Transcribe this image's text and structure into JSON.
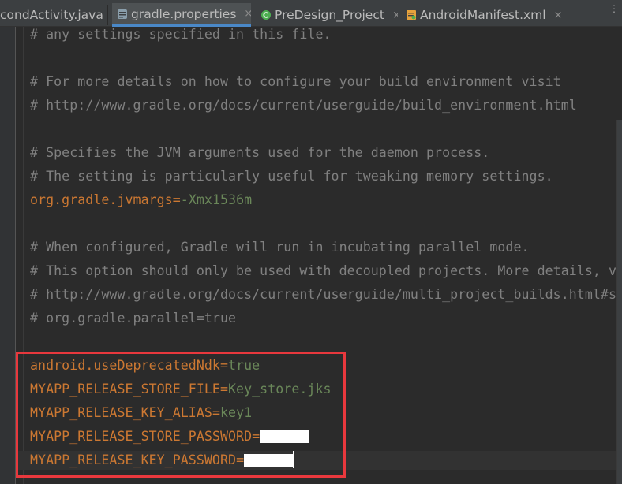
{
  "tabs": [
    {
      "label": "condActivity.java",
      "icon": "java-class-icon",
      "active": false
    },
    {
      "label": "gradle.properties",
      "icon": "gradle-properties-icon",
      "active": true
    },
    {
      "label": "PreDesign_Project",
      "icon": "gradle-module-icon",
      "active": false
    },
    {
      "label": "AndroidManifest.xml",
      "icon": "xml-manifest-icon",
      "active": false
    }
  ],
  "tab_close_glyph": "×",
  "tab_overflow_glyph": "⋮",
  "editor": {
    "lines": [
      {
        "type": "comment",
        "text": "# any settings specified in this file."
      },
      {
        "type": "blank",
        "text": ""
      },
      {
        "type": "comment",
        "text": "# For more details on how to configure your build environment visit"
      },
      {
        "type": "comment",
        "text": "# http://www.gradle.org/docs/current/userguide/build_environment.html"
      },
      {
        "type": "blank",
        "text": ""
      },
      {
        "type": "comment",
        "text": "# Specifies the JVM arguments used for the daemon process."
      },
      {
        "type": "comment",
        "text": "# The setting is particularly useful for tweaking memory settings."
      },
      {
        "type": "property",
        "key": "org.gradle.jvmargs",
        "eq": "=",
        "value": "-Xmx1536m"
      },
      {
        "type": "blank",
        "text": ""
      },
      {
        "type": "comment",
        "text": "# When configured, Gradle will run in incubating parallel mode."
      },
      {
        "type": "comment",
        "text": "# This option should only be used with decoupled projects. More details, visit"
      },
      {
        "type": "comment",
        "text": "# http://www.gradle.org/docs/current/userguide/multi_project_builds.html#sec:decoupled_projects"
      },
      {
        "type": "comment",
        "text": "# org.gradle.parallel=true"
      },
      {
        "type": "blank",
        "text": ""
      },
      {
        "type": "property",
        "key": "android.useDeprecatedNdk",
        "eq": "=",
        "value": "true"
      },
      {
        "type": "property",
        "key": "MYAPP_RELEASE_STORE_FILE",
        "eq": "=",
        "value": "Key_store.jks"
      },
      {
        "type": "property",
        "key": "MYAPP_RELEASE_KEY_ALIAS",
        "eq": "=",
        "value": "key1"
      },
      {
        "type": "property",
        "key": "MYAPP_RELEASE_STORE_PASSWORD",
        "eq": "=",
        "value": "",
        "redacted": true
      },
      {
        "type": "property",
        "key": "MYAPP_RELEASE_KEY_PASSWORD",
        "eq": "=",
        "value": "",
        "redacted": true,
        "current": true
      }
    ]
  },
  "colors": {
    "background": "#2b2b2b",
    "comment": "#808080",
    "key": "#cc7832",
    "value": "#6a8759",
    "highlight_box": "#e8383d",
    "active_tab_underline": "#4a88c7"
  }
}
